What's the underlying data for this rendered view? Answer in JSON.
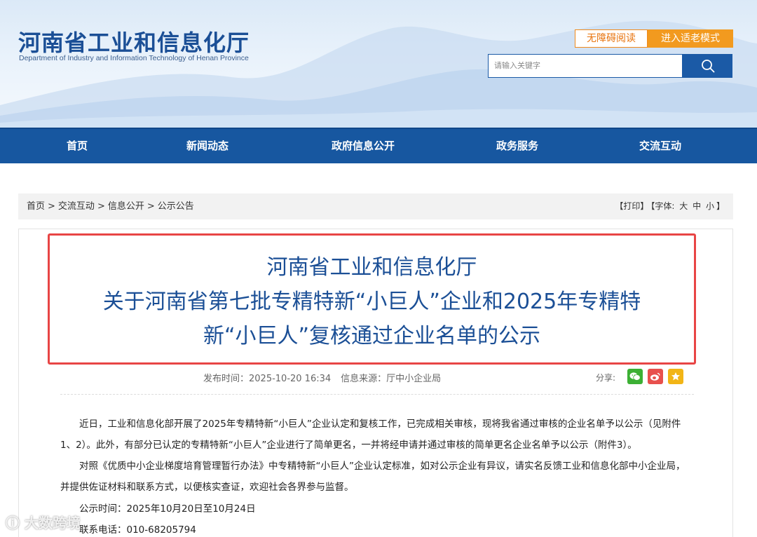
{
  "header": {
    "title": "河南省工业和信息化厅",
    "subtitle": "Department of Industry and Information Technology of Henan Province",
    "accessibility_btn": "无障碍阅读",
    "elder_btn": "进入适老模式",
    "search_placeholder": "请输入关键字",
    "search_icon": "search-icon"
  },
  "nav": [
    "首页",
    "新闻动态",
    "政府信息公开",
    "政务服务",
    "交流互动"
  ],
  "breadcrumb": {
    "items": [
      "首页",
      "交流互动",
      "信息公开",
      "公示公告"
    ],
    "separator": ">",
    "print": "【打印】",
    "font_label": "【字体:",
    "font_large": "大",
    "font_medium": "中",
    "font_small": "小",
    "font_close": "】"
  },
  "article": {
    "title_lines": [
      "河南省工业和信息化厅",
      "关于河南省第七批专精特新“小巨人”企业和2025年专精特",
      "新“小巨人”复核通过企业名单的公示"
    ],
    "publish_time": "发布时间：2025-10-20 16:34",
    "source": "信息来源：厅中小企业局",
    "share_label": "分享:",
    "share_icons": [
      "wechat-icon",
      "weibo-icon",
      "favorite-icon"
    ],
    "paragraphs": [
      "近日，工业和信息化部开展了2025年专精特新“小巨人”企业认定和复核工作，已完成相关审核，现将我省通过审核的企业名单予以公示（见附件1、2）。此外，有部分已认定的专精特新“小巨人”企业进行了简单更名，一并将经申请并通过审核的简单更名企业名单予以公示（附件3）。",
      "对照《优质中小企业梯度培育管理暂行办法》中专精特新“小巨人”企业认定标准，如对公示企业有异议，请实名反馈工业和信息化部中小企业局，并提供佐证材料和联系方式，以便核实查证，欢迎社会各界参与监督。"
    ],
    "notice_period": "公示时间：2025年10月20日至10月24日",
    "contact": "联系电话：010-68205794"
  },
  "watermark": "大数跨境",
  "colors": {
    "brand_blue": "#1b4f96",
    "nav_blue": "#1757a0",
    "orange": "#f29a1f",
    "highlight_red": "#e84545"
  }
}
